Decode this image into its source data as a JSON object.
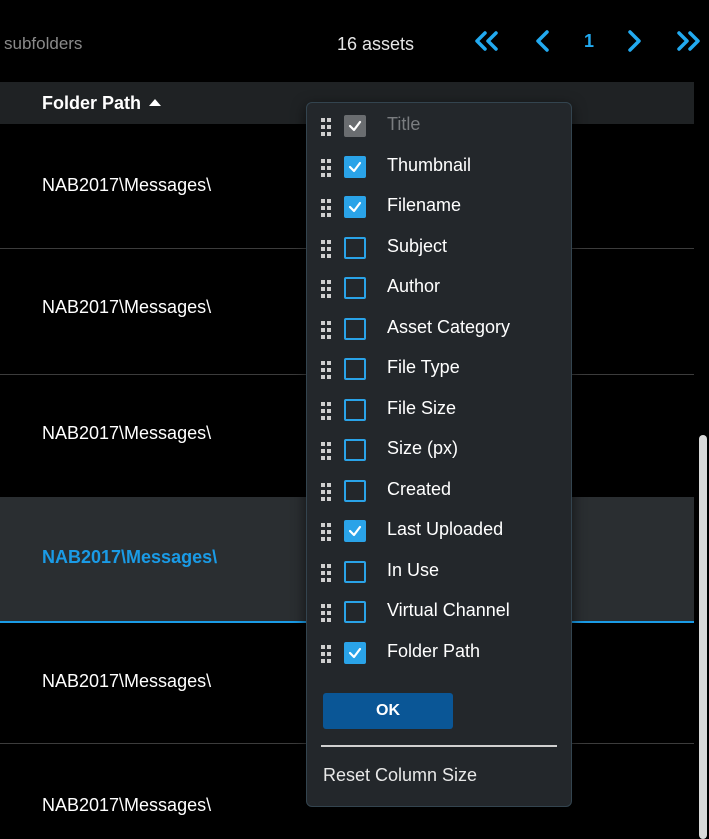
{
  "toolbar": {
    "subfolders_label": "subfolders",
    "asset_count": "16 assets",
    "page_number": "1"
  },
  "table": {
    "column_header": "Folder Path",
    "sort_direction": "ascending",
    "rows": [
      {
        "value": "NAB2017\\Messages\\",
        "selected": false
      },
      {
        "value": "NAB2017\\Messages\\",
        "selected": false
      },
      {
        "value": "NAB2017\\Messages\\",
        "selected": false
      },
      {
        "value": "NAB2017\\Messages\\",
        "selected": true
      },
      {
        "value": "NAB2017\\Messages\\",
        "selected": false
      },
      {
        "value": "NAB2017\\Messages\\",
        "selected": false
      }
    ]
  },
  "column_picker": {
    "options": [
      {
        "label": "Title",
        "checked": true,
        "disabled": true
      },
      {
        "label": "Thumbnail",
        "checked": true,
        "disabled": false
      },
      {
        "label": "Filename",
        "checked": true,
        "disabled": false
      },
      {
        "label": "Subject",
        "checked": false,
        "disabled": false
      },
      {
        "label": "Author",
        "checked": false,
        "disabled": false
      },
      {
        "label": "Asset Category",
        "checked": false,
        "disabled": false
      },
      {
        "label": "File Type",
        "checked": false,
        "disabled": false
      },
      {
        "label": "File Size",
        "checked": false,
        "disabled": false
      },
      {
        "label": "Size (px)",
        "checked": false,
        "disabled": false
      },
      {
        "label": "Created",
        "checked": false,
        "disabled": false
      },
      {
        "label": "Last Uploaded",
        "checked": true,
        "disabled": false
      },
      {
        "label": "In Use",
        "checked": false,
        "disabled": false
      },
      {
        "label": "Virtual Channel",
        "checked": false,
        "disabled": false
      },
      {
        "label": "Folder Path",
        "checked": true,
        "disabled": false
      }
    ],
    "ok_label": "OK",
    "reset_label": "Reset Column Size"
  },
  "colors": {
    "accent": "#1a9be6",
    "checkbox": "#2aa3e8",
    "ok_button": "#0a5696",
    "selected_row_bg": "#2a2e31",
    "header_bg": "#1f2224",
    "popup_bg": "#23272b"
  }
}
